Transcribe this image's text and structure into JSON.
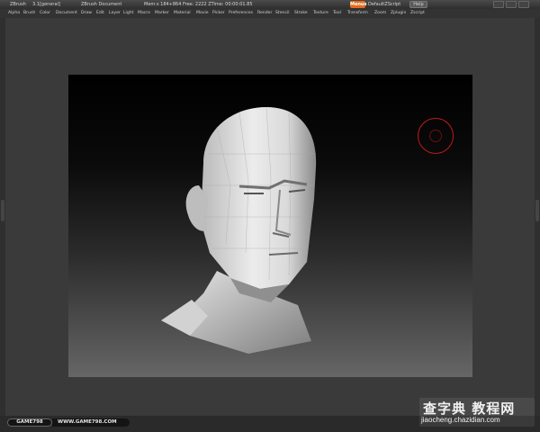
{
  "titlebar": {
    "app": "ZBrush",
    "version": "3.1[general]",
    "document": "ZBrush Document",
    "stats": "Mem:s 184+864  Free: 2222  ZTime: 00:00:01.85",
    "menus_button": "Menus",
    "script_label": "DefaultZScript",
    "help_button": "Help"
  },
  "menubar": {
    "items": [
      "Alpha",
      "Brush",
      "Color",
      "Document",
      "Draw",
      "Edit",
      "Layer",
      "Light",
      "Macro",
      "Marker",
      "Material",
      "Movie",
      "Picker",
      "Preferences",
      "Render",
      "Stencil",
      "Stroke",
      "Texture",
      "Tool",
      "Transform",
      "Zoom",
      "Zplugin",
      "Zscript"
    ]
  },
  "footer": {
    "badge": "GAME798",
    "site": "WWW.GAME798.COM"
  },
  "watermark": {
    "cn": "查字典 教程网",
    "url": "jiaocheng.chazidian.com"
  },
  "colors": {
    "accent_menus": "#e26a1a",
    "brush_ring": "#c21a1a",
    "chrome": "#3a3a3a"
  }
}
